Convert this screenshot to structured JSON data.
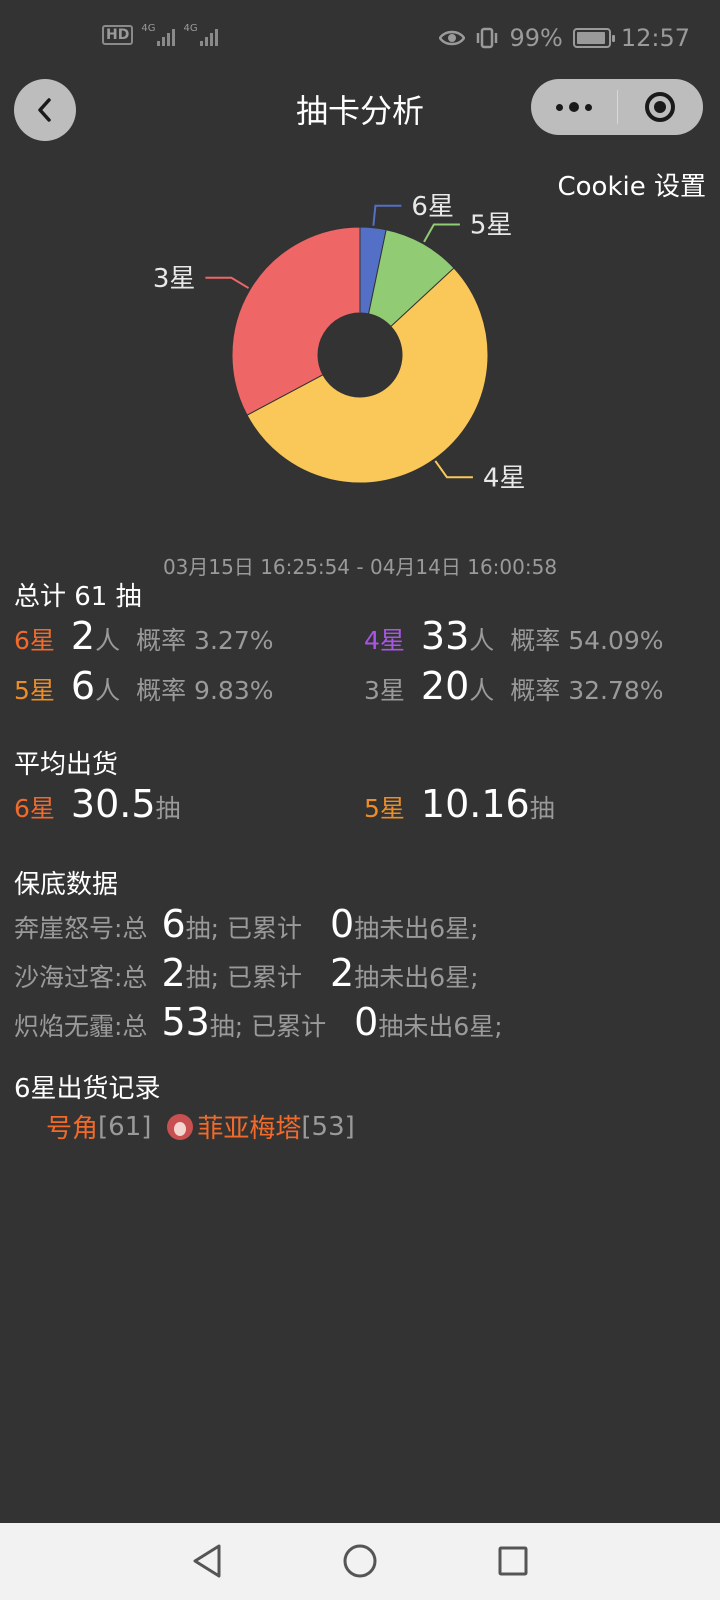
{
  "status_bar": {
    "hd": "HD",
    "net1": "4G",
    "net2": "4G",
    "battery_pct": "99%",
    "time": "12:57"
  },
  "nav": {
    "title": "抽卡分析",
    "cookie_settings": "Cookie 设置"
  },
  "chart_data": {
    "type": "pie",
    "variant": "donut",
    "slices": [
      {
        "label": "6星",
        "value": 2,
        "color": "#5470c6"
      },
      {
        "label": "5星",
        "value": 6,
        "color": "#91cc75"
      },
      {
        "label": "4星",
        "value": 33,
        "color": "#fac858"
      },
      {
        "label": "3星",
        "value": 20,
        "color": "#ee6666"
      }
    ]
  },
  "date_range": "03月15日 16:25:54  -  04月14日 16:00:58",
  "total": {
    "title": "总计 61 抽",
    "rows": [
      {
        "star": "6星",
        "count": "2",
        "unit": "人",
        "rate": "概率 3.27%"
      },
      {
        "star": "4星",
        "count": "33",
        "unit": "人",
        "rate": "概率 54.09%"
      },
      {
        "star": "5星",
        "count": "6",
        "unit": "人",
        "rate": "概率 9.83%"
      },
      {
        "star": "3星",
        "count": "20",
        "unit": "人",
        "rate": "概率 32.78%"
      }
    ]
  },
  "average": {
    "title": "平均出货",
    "six_star": "6星",
    "six_value": "30.5",
    "five_star": "5星",
    "five_value": "10.16",
    "unit": "抽"
  },
  "pity": {
    "title": "保底数据",
    "rows": [
      {
        "pool": "奔崖怒号:总",
        "total": "6",
        "mid": "抽;  已累计",
        "accum": "0",
        "tail": "抽未出6星;"
      },
      {
        "pool": "沙海过客:总",
        "total": "2",
        "mid": "抽;  已累计",
        "accum": "2",
        "tail": "抽未出6星;"
      },
      {
        "pool": "炽焰无霾:总",
        "total": "53",
        "mid": "抽;  已累计",
        "accum": "0",
        "tail": "抽未出6星;"
      }
    ]
  },
  "records": {
    "title": "6星出货记录",
    "items": [
      {
        "name": "号角",
        "count": "[61]"
      },
      {
        "name": "菲亚梅塔",
        "count": "[53]"
      }
    ]
  },
  "colors": {
    "background": "#333333",
    "six_star": "#f26a2a",
    "five_star": "#ec8d26",
    "four_star": "#a855e8",
    "three_star": "#9a9a9a"
  },
  "icons": {
    "back": "chevron-left-icon",
    "more": "more-dots-icon",
    "close": "target-icon"
  }
}
